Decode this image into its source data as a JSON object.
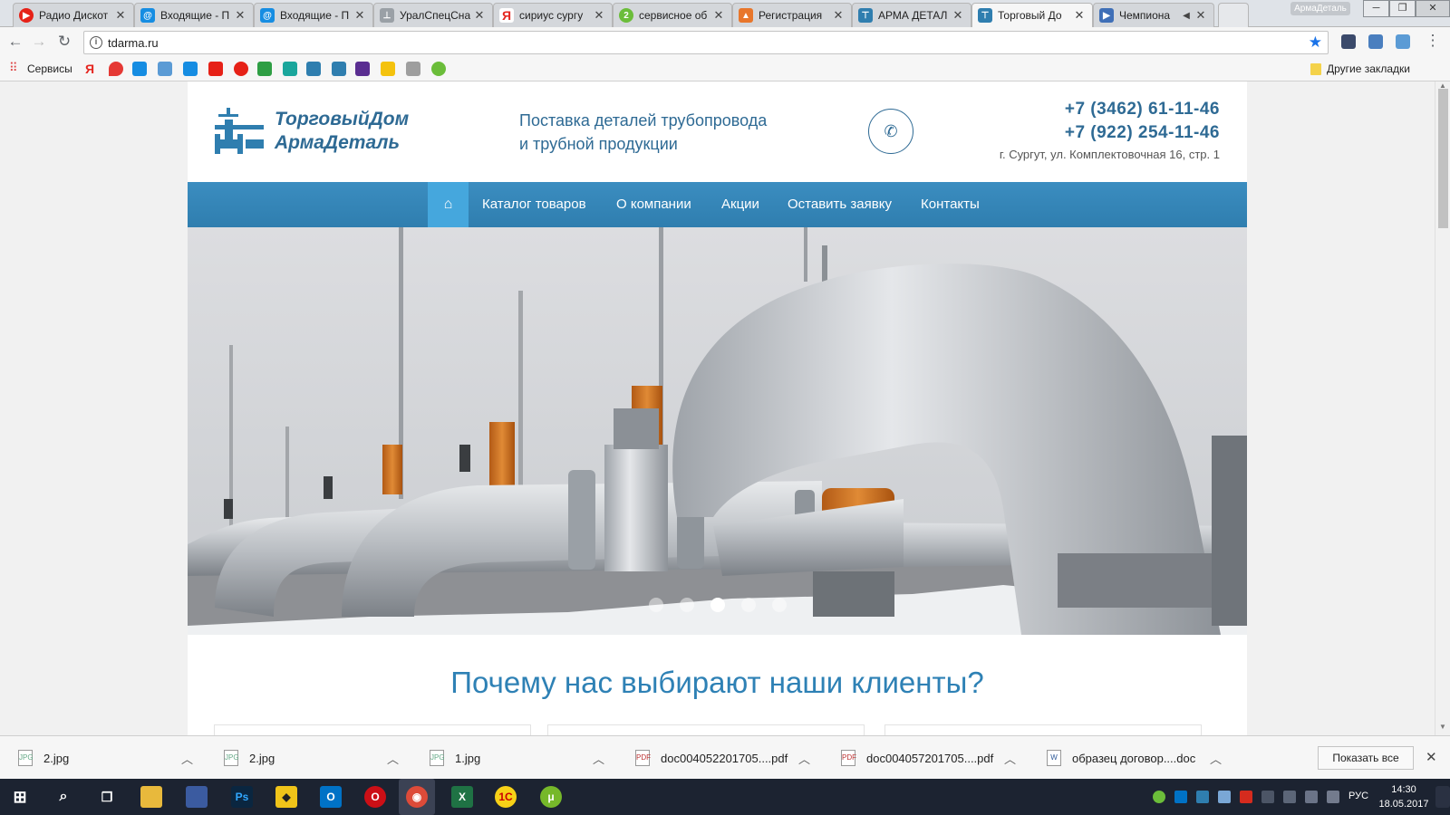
{
  "browser": {
    "tabs": [
      {
        "title": "Радио Дискот",
        "icon_color": "#e62117",
        "icon": "play-icon"
      },
      {
        "title": "Входящие - П",
        "icon_color": "#168de2",
        "icon": "mail-icon"
      },
      {
        "title": "Входящие - П",
        "icon_color": "#168de2",
        "icon": "mail-icon"
      },
      {
        "title": "УралСпецСна",
        "icon_color": "#888888",
        "icon": "pipe-icon"
      },
      {
        "title": "сириус сургу",
        "icon_color": "#e52620",
        "icon": "yandex-icon"
      },
      {
        "title": "сервисное об",
        "icon_color": "#6bbd3a",
        "icon": "2gis-icon"
      },
      {
        "title": "Регистрация",
        "icon_color": "#e8762b",
        "icon": "registration-icon"
      },
      {
        "title": "АРМА ДЕТАЛ",
        "icon_color": "#2f7eaf",
        "icon": "arma-icon"
      },
      {
        "title": "Торговый До",
        "icon_color": "#2f7eaf",
        "icon": "arma-icon"
      },
      {
        "title": "Чемпиона",
        "icon_color": "#3f6fb7",
        "icon": "video-icon"
      }
    ],
    "profile_name": "АрмаДеталь",
    "url": "tdarma.ru",
    "bookmarks_label": "Сервисы",
    "other_bookmarks": "Другие закладки"
  },
  "site": {
    "logo_line1": "ТорговыйДом",
    "logo_line2": "АрмаДеталь",
    "tagline_line1": "Поставка деталей трубопровода",
    "tagline_line2": "и трубной продукции",
    "phone1": "+7 (3462) 61-11-46",
    "phone2": "+7 (922) 254-11-46",
    "address": "г. Сургут, ул. Комплектовочная 16, стр. 1",
    "nav": [
      "Каталог товаров",
      "О компании",
      "Акции",
      "Оставить заявку",
      "Контакты"
    ],
    "slider_dots": 5,
    "slider_active": 3,
    "why_heading": "Почему нас выбирают наши клиенты?"
  },
  "downloads": {
    "items": [
      "2.jpg",
      "2.jpg",
      "1.jpg",
      "doc004052201705....pdf",
      "doc004057201705....pdf",
      "образец договор....doc"
    ],
    "show_all": "Показать все"
  },
  "taskbar": {
    "lang": "РУС",
    "time": "14:30",
    "date": "18.05.2017"
  },
  "colors": {
    "brand_blue": "#2e6a94",
    "nav_bg": "#2f7eaf",
    "nav_active": "#45a7dd",
    "heading": "#2e81b5"
  }
}
